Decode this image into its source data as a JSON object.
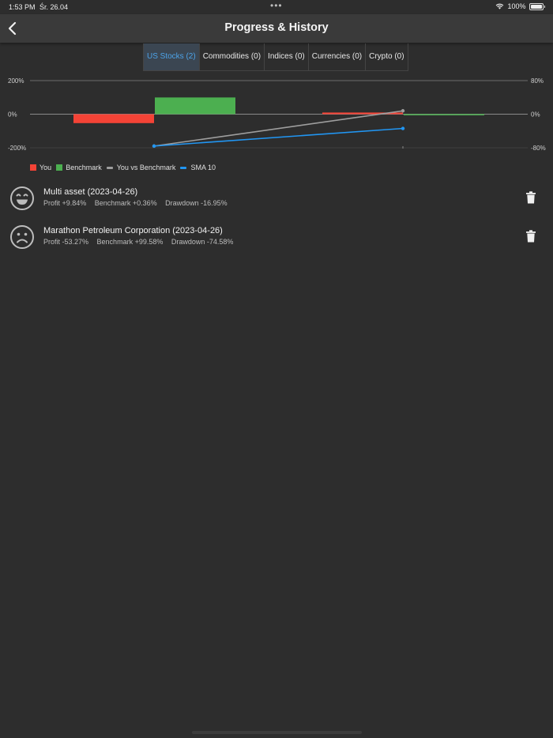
{
  "status_bar": {
    "time": "1:53 PM",
    "date": "Śr. 26.04",
    "battery": "100%"
  },
  "header": {
    "title": "Progress & History",
    "back_icon": "chevron-left-icon"
  },
  "tabs": [
    {
      "label": "US Stocks (2)",
      "active": true
    },
    {
      "label": "Commodities (0)",
      "active": false
    },
    {
      "label": "Indices (0)",
      "active": false
    },
    {
      "label": "Currencies (0)",
      "active": false
    },
    {
      "label": "Crypto (0)",
      "active": false
    }
  ],
  "chart_data": {
    "type": "bar",
    "left_axis": {
      "ticks": [
        "200%",
        "0%",
        "-200%"
      ],
      "ylim": [
        -200,
        200
      ]
    },
    "right_axis": {
      "ticks": [
        "80%",
        "0%",
        "-80%"
      ],
      "ylim": [
        -80,
        80
      ]
    },
    "categories": [
      "1",
      "2"
    ],
    "series": [
      {
        "name": "You",
        "type": "bar",
        "color": "#f44336",
        "values": [
          -53.27,
          9.84
        ]
      },
      {
        "name": "Benchmark",
        "type": "bar",
        "color": "#4caf50",
        "values": [
          99.58,
          0.36
        ]
      },
      {
        "name": "You vs Benchmark",
        "type": "line",
        "color": "#9e9e9e",
        "axis": "right",
        "values": [
          -76,
          8
        ]
      },
      {
        "name": "SMA 10",
        "type": "line",
        "color": "#2196f3",
        "axis": "right",
        "values": [
          -76,
          -34
        ]
      }
    ]
  },
  "history": [
    {
      "mood": "happy-face-icon",
      "title": "Multi asset (2023-04-26)",
      "profit": "Profit +9.84%",
      "benchmark": "Benchmark +0.36%",
      "drawdown": "Drawdown -16.95%"
    },
    {
      "mood": "sad-face-icon",
      "title": "Marathon Petroleum Corporation (2023-04-26)",
      "profit": "Profit -53.27%",
      "benchmark": "Benchmark +99.58%",
      "drawdown": "Drawdown -74.58%"
    }
  ],
  "icons": {
    "delete": "trash-icon"
  },
  "colors": {
    "accent": "#4da3e8",
    "background": "#2d2d2d",
    "navbar": "#3a3a3a"
  }
}
